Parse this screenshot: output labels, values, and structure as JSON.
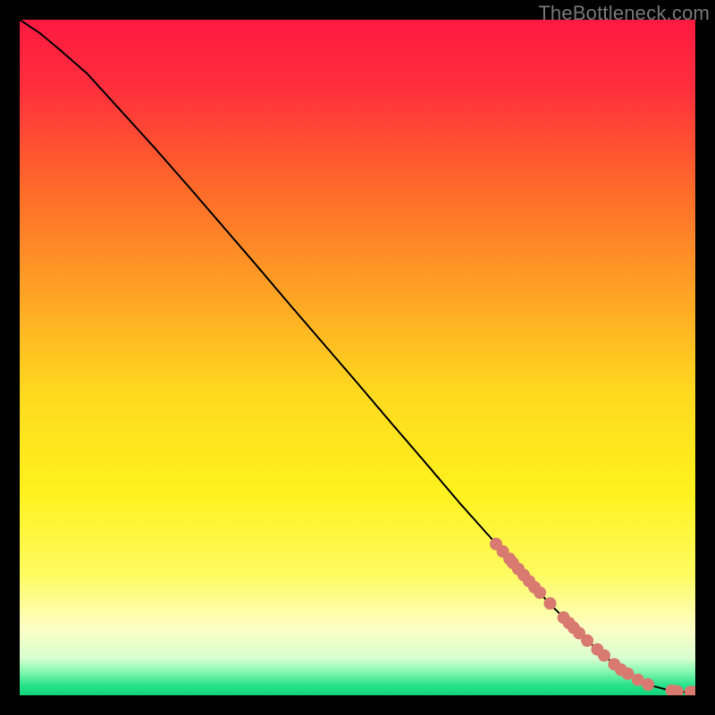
{
  "watermark": "TheBottleneck.com",
  "colors": {
    "background": "#000000",
    "gradient_stops": [
      {
        "offset": 0.0,
        "color": "#ff1a40"
      },
      {
        "offset": 0.1,
        "color": "#ff2e3d"
      },
      {
        "offset": 0.25,
        "color": "#ff6a2a"
      },
      {
        "offset": 0.4,
        "color": "#ffa125"
      },
      {
        "offset": 0.55,
        "color": "#ffd91f"
      },
      {
        "offset": 0.7,
        "color": "#fff21e"
      },
      {
        "offset": 0.82,
        "color": "#fffb60"
      },
      {
        "offset": 0.9,
        "color": "#fdffc4"
      },
      {
        "offset": 0.945,
        "color": "#d9ffd0"
      },
      {
        "offset": 0.965,
        "color": "#85f7b0"
      },
      {
        "offset": 0.985,
        "color": "#29e28a"
      },
      {
        "offset": 1.0,
        "color": "#0fd47a"
      }
    ],
    "line": "#000000",
    "marker": "#d97a70"
  },
  "chart_data": {
    "type": "line",
    "title": "",
    "xlabel": "",
    "ylabel": "",
    "xlim": [
      0,
      100
    ],
    "ylim": [
      0,
      100
    ],
    "grid": false,
    "series": [
      {
        "name": "curve",
        "x": [
          0,
          3,
          6,
          10,
          15,
          20,
          25,
          30,
          35,
          40,
          45,
          50,
          55,
          60,
          65,
          70,
          73,
          76,
          79,
          82,
          85,
          88,
          90,
          92,
          94,
          95.5,
          97,
          98,
          99,
          100
        ],
        "y": [
          100,
          98,
          95.5,
          92,
          86.5,
          81,
          75.3,
          69.5,
          63.7,
          57.8,
          52,
          46.2,
          40.3,
          34.5,
          28.6,
          23,
          19.5,
          16.2,
          13,
          10,
          7.2,
          4.6,
          3.2,
          2.1,
          1.3,
          0.9,
          0.6,
          0.5,
          0.5,
          0.5
        ]
      }
    ],
    "markers": {
      "name": "points",
      "x": [
        70.5,
        71.5,
        72.5,
        73.0,
        73.8,
        74.6,
        75.4,
        76.2,
        77.0,
        78.5,
        80.5,
        81.3,
        82.0,
        82.8,
        84.0,
        85.5,
        86.5,
        88.0,
        89.0,
        90.0,
        91.5,
        93.0,
        96.5,
        97.3,
        99.3,
        100.0
      ],
      "y": [
        22.4,
        21.3,
        20.2,
        19.6,
        18.7,
        17.8,
        16.9,
        16.0,
        15.2,
        13.6,
        11.5,
        10.7,
        10.0,
        9.2,
        8.1,
        6.8,
        5.9,
        4.6,
        3.8,
        3.2,
        2.3,
        1.6,
        0.7,
        0.6,
        0.5,
        0.5
      ],
      "r": 7
    }
  }
}
